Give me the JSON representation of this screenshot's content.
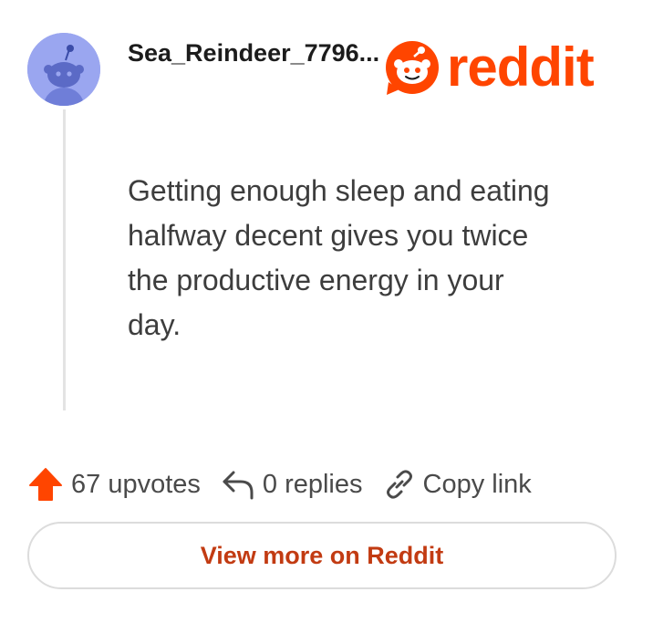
{
  "comment": {
    "author": "Sea_Reindeer_7796...",
    "body": "Getting enough sleep and eating halfway decent gives you twice the productive energy in your day."
  },
  "brand": {
    "wordmark": "reddit",
    "logo_icon": "reddit-snoo-logo-icon",
    "color": "#ff4500"
  },
  "actions": {
    "upvotes_label": "67 upvotes",
    "upvote_icon": "upvote-arrow-icon",
    "replies_label": "0 replies",
    "reply_icon": "reply-arrow-icon",
    "copy_link_label": "Copy link",
    "copy_link_icon": "link-icon"
  },
  "footer": {
    "view_more_label": "View more on Reddit"
  },
  "colors": {
    "accent": "#ff4500",
    "avatar_bg": "#9aa6f0",
    "link_text": "#c23b12"
  }
}
